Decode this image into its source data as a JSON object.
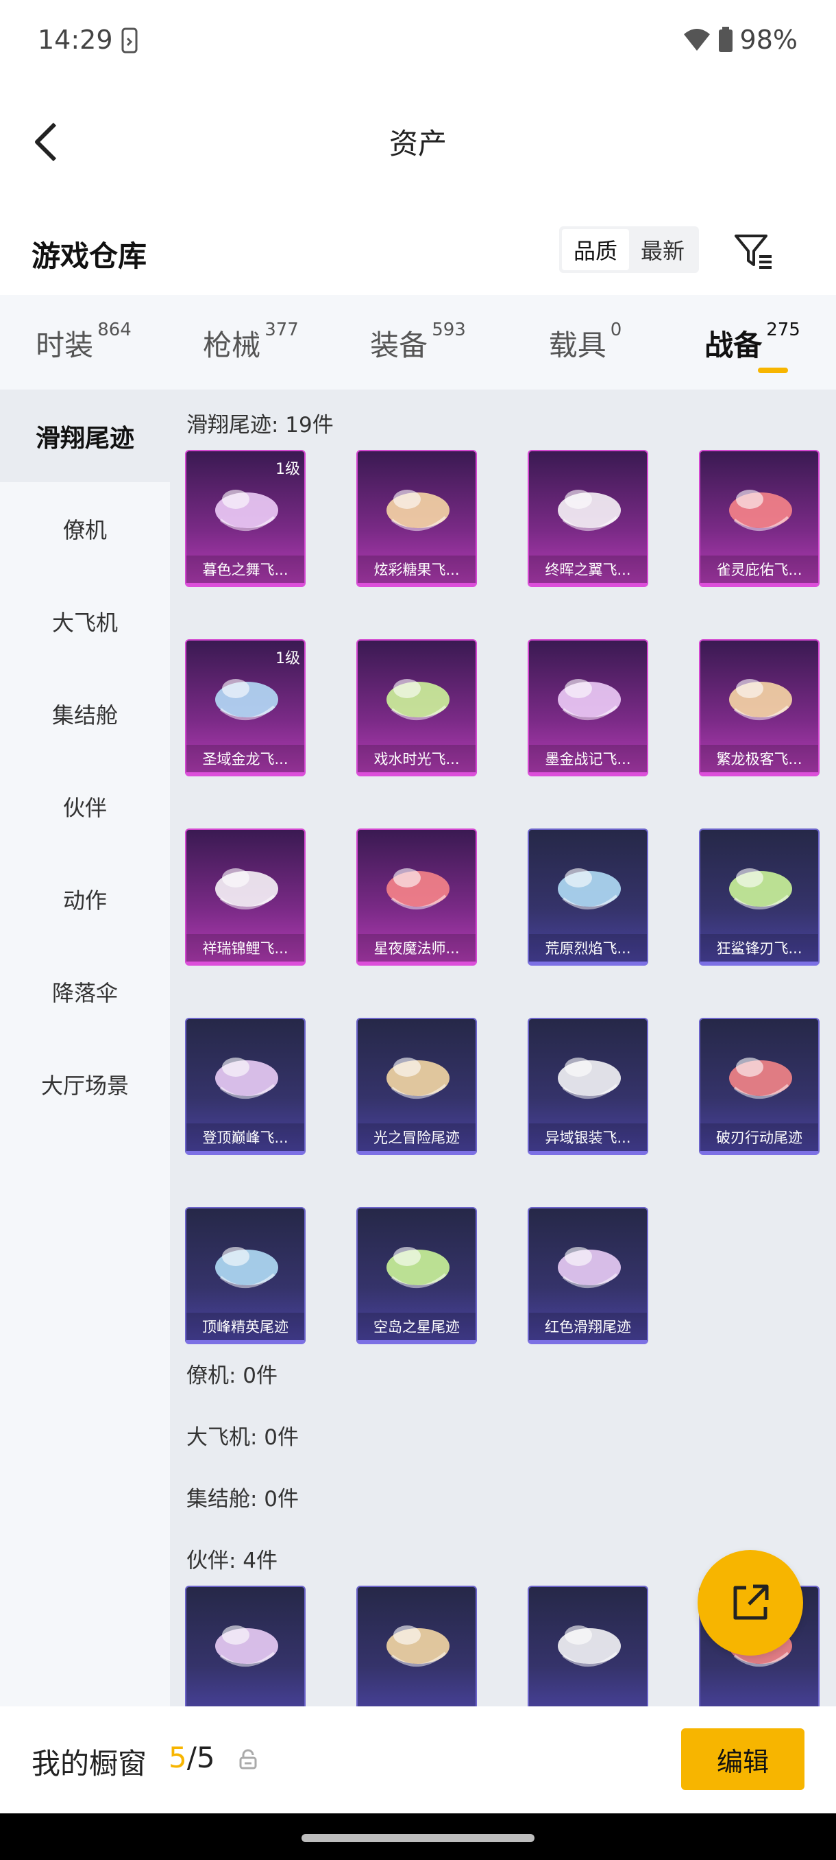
{
  "status_bar": {
    "time": "14:29",
    "battery": "98%"
  },
  "header": {
    "title": "资产"
  },
  "warehouse": {
    "title": "游戏仓库",
    "sort_options": [
      {
        "label": "品质",
        "active": true
      },
      {
        "label": "最新",
        "active": false
      }
    ]
  },
  "tabs": [
    {
      "label": "时装",
      "count": "864",
      "active": false
    },
    {
      "label": "枪械",
      "count": "377",
      "active": false
    },
    {
      "label": "装备",
      "count": "593",
      "active": false
    },
    {
      "label": "载具",
      "count": "0",
      "active": false
    },
    {
      "label": "战备",
      "count": "275",
      "active": true
    }
  ],
  "sidebar": {
    "items": [
      {
        "label": "滑翔尾迹",
        "active": true
      },
      {
        "label": "僚机",
        "active": false
      },
      {
        "label": "大飞机",
        "active": false
      },
      {
        "label": "集结舱",
        "active": false
      },
      {
        "label": "伙伴",
        "active": false
      },
      {
        "label": "动作",
        "active": false
      },
      {
        "label": "降落伞",
        "active": false
      },
      {
        "label": "大厅场景",
        "active": false
      }
    ]
  },
  "sections": [
    {
      "label": "滑翔尾迹: 19件",
      "items": [
        {
          "name": "暮色之舞飞...",
          "level": "1级",
          "rarity": "pink"
        },
        {
          "name": "炫彩糖果飞...",
          "level": "",
          "rarity": "pink"
        },
        {
          "name": "终晖之翼飞...",
          "level": "",
          "rarity": "pink"
        },
        {
          "name": "雀灵庇佑飞...",
          "level": "",
          "rarity": "pink"
        },
        {
          "name": "圣域金龙飞...",
          "level": "1级",
          "rarity": "pink"
        },
        {
          "name": "戏水时光飞...",
          "level": "",
          "rarity": "pink"
        },
        {
          "name": "墨金战记飞...",
          "level": "",
          "rarity": "pink"
        },
        {
          "name": "繁龙极客飞...",
          "level": "",
          "rarity": "pink"
        },
        {
          "name": "祥瑞锦鲤飞...",
          "level": "",
          "rarity": "pink"
        },
        {
          "name": "星夜魔法师...",
          "level": "",
          "rarity": "pink"
        },
        {
          "name": "荒原烈焰飞...",
          "level": "",
          "rarity": "blue"
        },
        {
          "name": "狂鲨锋刃飞...",
          "level": "",
          "rarity": "blue"
        },
        {
          "name": "登顶巅峰飞...",
          "level": "",
          "rarity": "blue"
        },
        {
          "name": "光之冒险尾迹",
          "level": "",
          "rarity": "blue"
        },
        {
          "name": "异域银装飞...",
          "level": "",
          "rarity": "blue"
        },
        {
          "name": "破刃行动尾迹",
          "level": "",
          "rarity": "blue"
        },
        {
          "name": "顶峰精英尾迹",
          "level": "",
          "rarity": "blue"
        },
        {
          "name": "空岛之星尾迹",
          "level": "",
          "rarity": "blue"
        },
        {
          "name": "红色滑翔尾迹",
          "level": "",
          "rarity": "blue"
        }
      ]
    },
    {
      "label": "僚机: 0件",
      "items": []
    },
    {
      "label": "大飞机: 0件",
      "items": []
    },
    {
      "label": "集结舱: 0件",
      "items": []
    },
    {
      "label": "伙伴: 4件",
      "items": [
        {
          "name": "",
          "level": "",
          "rarity": "blue"
        },
        {
          "name": "",
          "level": "",
          "rarity": "blue"
        },
        {
          "name": "",
          "level": "",
          "rarity": "blue"
        },
        {
          "name": "",
          "level": "",
          "rarity": "blue"
        }
      ]
    }
  ],
  "bottom_bar": {
    "label": "我的橱窗",
    "count_current": "5",
    "count_total": "/5",
    "edit_label": "编辑"
  },
  "colors": {
    "accent": "#f7b500",
    "card_pink": "#dc4fda",
    "card_blue": "#7c70e4"
  },
  "icons": [
    "back-arrow-icon",
    "filter-icon",
    "share-icon",
    "lock-icon",
    "phone-icon",
    "wifi-icon",
    "battery-icon"
  ]
}
